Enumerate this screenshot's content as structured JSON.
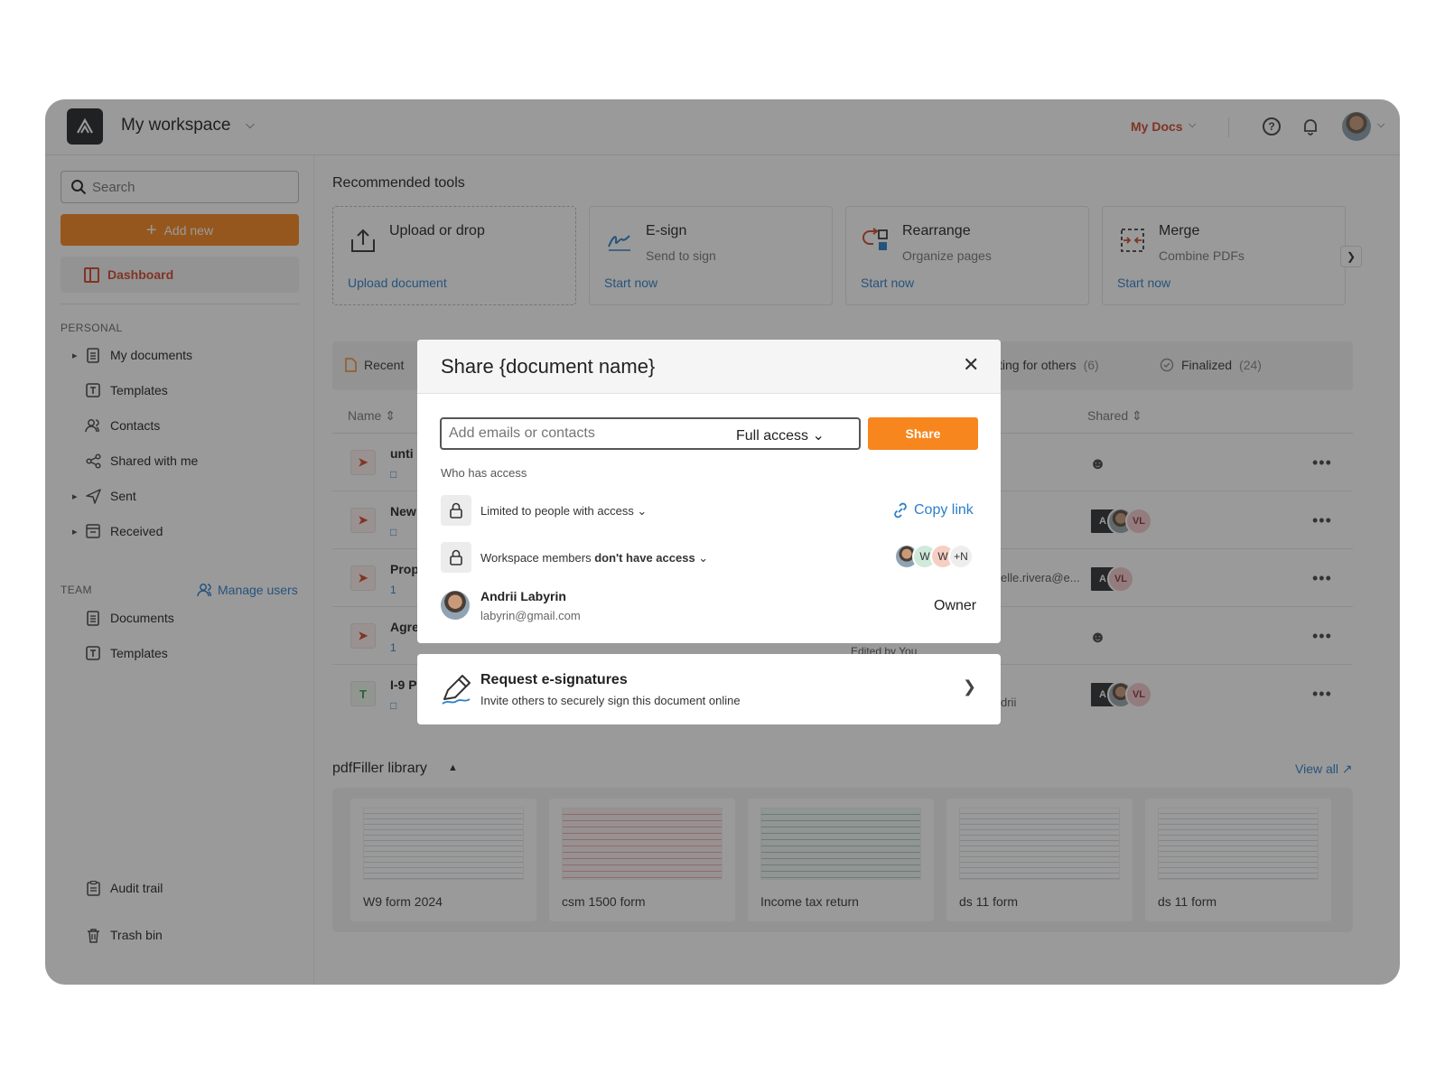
{
  "header": {
    "workspace_title": "My workspace",
    "my_docs_label": "My Docs"
  },
  "sidebar": {
    "search_placeholder": "Search",
    "add_new_label": "Add new",
    "dashboard_label": "Dashboard",
    "personal_label": "PERSONAL",
    "personal_items": [
      "My documents",
      "Templates",
      "Contacts",
      "Shared with me",
      "Sent",
      "Received"
    ],
    "team_label": "TEAM",
    "manage_users_label": "Manage users",
    "team_items": [
      "Documents",
      "Templates"
    ],
    "audit_label": "Audit trail",
    "trash_label": "Trash bin"
  },
  "tools": {
    "section_title": "Recommended tools",
    "items": [
      {
        "title": "Upload or drop",
        "subtitle": "",
        "link": "Upload document"
      },
      {
        "title": "E-sign",
        "subtitle": "Send to sign",
        "link": "Start now"
      },
      {
        "title": "Rearrange",
        "subtitle": "Organize pages",
        "link": "Start now"
      },
      {
        "title": "Merge",
        "subtitle": "Combine PDFs",
        "link": "Start now"
      }
    ]
  },
  "tabs": {
    "recent": "Recent",
    "waiting_partial": "ting for others",
    "waiting_count": "(6)",
    "finalized": "Finalized",
    "finalized_count": "(24)"
  },
  "table": {
    "col_name": "Name",
    "col_shared": "Shared",
    "rows": [
      {
        "name": "unti",
        "comments": "",
        "extra": ""
      },
      {
        "name": "New",
        "comments": "",
        "extra": ""
      },
      {
        "name": "Prop",
        "comments": "1",
        "extra": "elle.rivera@e..."
      },
      {
        "name": "Agre",
        "comments": "1",
        "extra": "Edited by You"
      },
      {
        "name": "I-9 P",
        "comments": "",
        "extra": "drii"
      }
    ],
    "avatar_initials": "VL"
  },
  "library": {
    "title": "pdfFiller library",
    "view_all": "View all",
    "items": [
      "W9 form 2024",
      "csm 1500 form",
      "Income tax return",
      "ds 11 form",
      "ds 11 form"
    ]
  },
  "modal": {
    "title": "Share {document name}",
    "email_placeholder": "Add emails or contacts",
    "access_level": "Full access",
    "share_button": "Share",
    "who_has_access": "Who has access",
    "limited_access": "Limited to people with access",
    "copy_link": "Copy link",
    "workspace_prefix": "Workspace members",
    "workspace_bold": "don't have access",
    "member_badges": [
      "W",
      "W",
      "+N"
    ],
    "owner_name": "Andrii Labyrin",
    "owner_email": "labyrin@gmail.com",
    "owner_role": "Owner"
  },
  "esign_panel": {
    "title": "Request e-signatures",
    "subtitle": "Invite others to securely sign this document online"
  },
  "colors": {
    "accent_orange": "#f7861e",
    "brand_red": "#d0452a",
    "link_blue": "#2c7fc7"
  }
}
